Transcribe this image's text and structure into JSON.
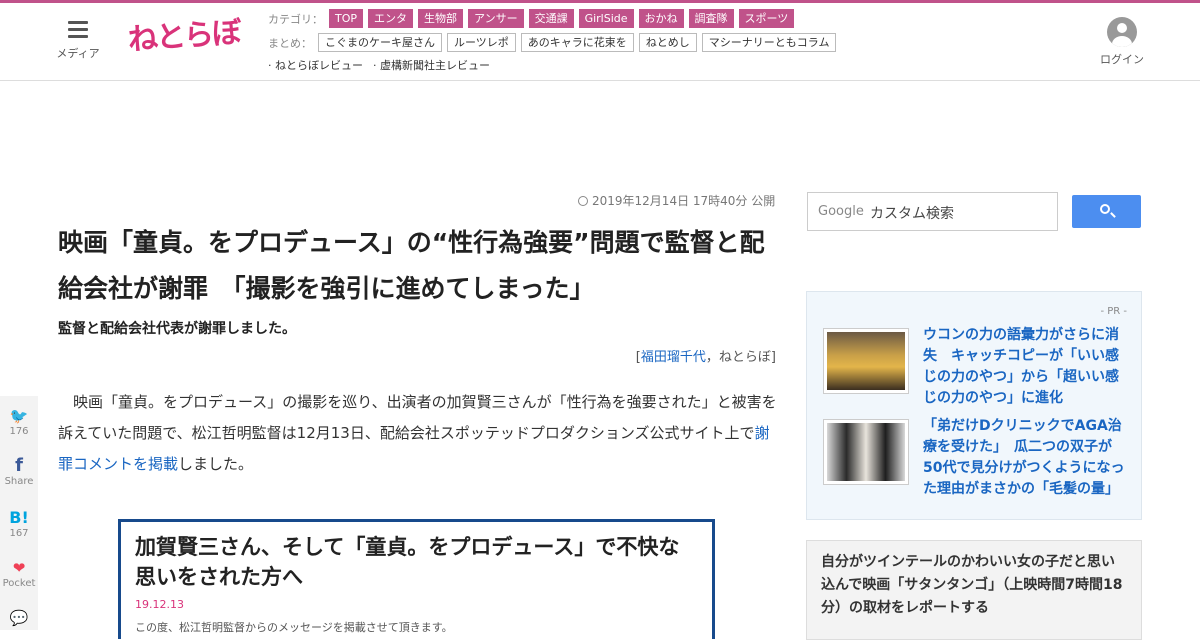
{
  "header": {
    "menu_label": "メディア",
    "logo_text": "ねとらぼ",
    "category_label": "カテゴリ：",
    "categories": [
      "TOP",
      "エンタ",
      "生物部",
      "アンサー",
      "交通課",
      "GirlSide",
      "おかね",
      "調査隊",
      "スポーツ"
    ],
    "summary_label": "まとめ：",
    "summaries": [
      "こぐまのケーキ屋さん",
      "ルーツレポ",
      "あのキャラに花束を",
      "ねとめし",
      "マシーナリーともコラム"
    ],
    "reviews": [
      "· ねとらぼレビュー",
      "· 虚構新聞社主レビュー"
    ],
    "login_label": "ログイン",
    "accent_color": "#c0528a"
  },
  "article": {
    "date": "2019年12月14日 17時40分 公開",
    "title": "映画「童貞。をプロデュース」の“性行為強要”問題で監督と配給会社が謝罪　「撮影を強引に進めてしまった」",
    "subtitle": "監督と配給会社代表が謝罪しました。",
    "byline_open": "[",
    "author": "福田瑠千代",
    "byline_sep": "，",
    "outlet": "ねとらぼ",
    "byline_close": "]",
    "body_prefix": "　映画「童貞。をプロデュース」の撮影を巡り、出演者の加賀賢三さんが「性行為を強要された」と被害を訴えていた問題で、松江哲明監督は12月13日、配給会社スポッテッドプロダクションズ公式サイト上で",
    "body_link": "謝罪コメントを掲載",
    "body_suffix": "しました。",
    "embed_title": "加賀賢三さん、そして「童貞。をプロデュース」で不快な思いをされた方へ",
    "embed_date": "19.12.13",
    "embed_excerpt": "この度、松江哲明監督からのメッセージを掲載させて頂きます。"
  },
  "share": [
    {
      "icon": "twitter-icon",
      "glyph": "🐦",
      "count": "176"
    },
    {
      "icon": "facebook-icon",
      "glyph": "f",
      "count": "Share"
    },
    {
      "icon": "hatena-icon",
      "glyph": "B!",
      "count": "167"
    },
    {
      "icon": "pocket-icon",
      "glyph": "❤",
      "count": "Pocket"
    },
    {
      "icon": "comment-icon",
      "glyph": "💬",
      "count": ""
    }
  ],
  "sidebar": {
    "search_brand": "Google",
    "search_placeholder": "カスタム検索",
    "pr_label": "- PR -",
    "pr_items": [
      {
        "text": "ウコンの力の語彙力がさらに消失　キャッチコピーが「いい感じの力のやつ」から「超いい感じの力のやつ」に進化"
      },
      {
        "text": "「弟だけDクリニックでAGA治療を受けた」　瓜二つの双子が50代で見分けがつくようになった理由がまさかの「毛髪の量」"
      }
    ],
    "related_title": "自分がツインテールのかわいい女の子だと思い込んで映画「サタンタンゴ」（上映時間7時間18分）の取材をレポートする"
  }
}
